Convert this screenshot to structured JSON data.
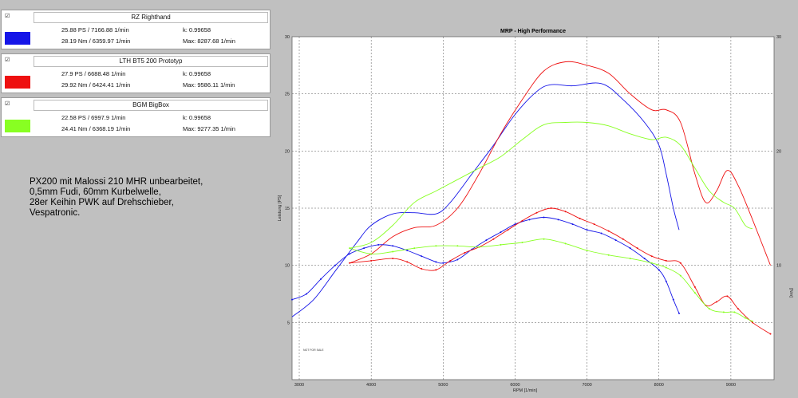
{
  "legend": [
    {
      "name": "RZ Righthand",
      "color": "#1515e8",
      "ps": "25.88 PS / 7166.88 1/min",
      "nm": "28.19 Nm / 6359.97 1/min",
      "k": "k: 0.99658",
      "max": "Max: 8287.68 1/min",
      "checkbox": "☑"
    },
    {
      "name": "LTH BT5 200 Prototyp",
      "color": "#ee1010",
      "ps": "27.9 PS / 6688.48 1/min",
      "nm": "29.92 Nm / 6424.41 1/min",
      "k": "k: 0.99658",
      "max": "Max: 9586.11 1/min",
      "checkbox": "☑"
    },
    {
      "name": "BGM BigBox",
      "color": "#88ff22",
      "ps": "22.58 PS / 6997.9 1/min",
      "nm": "24.41 Nm / 6368.19 1/min",
      "k": "k: 0.99658",
      "max": "Max: 9277.35 1/min",
      "checkbox": "☑"
    }
  ],
  "note_lines": [
    "PX200 mit Malossi 210 MHR unbearbeitet,",
    "0,5mm Fudi, 60mm Kurbelwelle,",
    "28er Keihin PWK auf Drehschieber,",
    "Vespatronic."
  ],
  "chart_data": {
    "type": "line",
    "title": "MRP - High Performance",
    "xlabel": "RPM [1/min]",
    "ylabel": "Leistung [PS]",
    "y2label": "[Nm]",
    "watermark": "NOT FOR SALE",
    "xlim": [
      2900,
      9600
    ],
    "ylim": [
      0,
      30
    ],
    "y2lim": [
      0,
      30
    ],
    "xticks": [
      3000,
      4000,
      5000,
      6000,
      7000,
      8000,
      9000
    ],
    "yticks": [
      5,
      10,
      15,
      20,
      25,
      30
    ],
    "y2ticks": [
      10,
      20,
      30
    ],
    "grid": true,
    "power_series": [
      {
        "name": "RZ Righthand",
        "color": "#1515e8",
        "x": [
          2900,
          3200,
          3500,
          3800,
          4000,
          4300,
          4600,
          4900,
          5100,
          5400,
          5700,
          6000,
          6300,
          6500,
          6800,
          7200,
          7500,
          7800,
          8000,
          8100,
          8200,
          8280
        ],
        "y": [
          5.5,
          7.0,
          9.5,
          12.0,
          13.5,
          14.5,
          14.6,
          14.5,
          15.5,
          18.0,
          20.5,
          23.2,
          25.2,
          25.8,
          25.7,
          25.9,
          24.5,
          22.5,
          20.5,
          18.0,
          15.0,
          13.1
        ]
      },
      {
        "name": "LTH BT5 200 Prototyp",
        "color": "#ee1010",
        "x": [
          3700,
          4000,
          4300,
          4600,
          4900,
          5200,
          5500,
          5800,
          6100,
          6400,
          6700,
          7000,
          7300,
          7600,
          7900,
          8100,
          8300,
          8500,
          8650,
          8800,
          8950,
          9100,
          9300,
          9550
        ],
        "y": [
          10.2,
          11.0,
          12.5,
          13.3,
          13.5,
          15.0,
          18.0,
          21.5,
          24.5,
          27.0,
          27.8,
          27.5,
          26.8,
          25.0,
          23.6,
          23.6,
          22.5,
          18.0,
          15.5,
          16.5,
          18.3,
          17.0,
          14.0,
          10.0
        ]
      },
      {
        "name": "BGM BigBox",
        "color": "#88ff22",
        "x": [
          3700,
          4000,
          4300,
          4600,
          4900,
          5200,
          5500,
          5800,
          6100,
          6400,
          6700,
          7000,
          7300,
          7600,
          7900,
          8100,
          8300,
          8500,
          8700,
          8900,
          9050,
          9200,
          9300
        ],
        "y": [
          11.5,
          12.0,
          13.5,
          15.5,
          16.5,
          17.5,
          18.5,
          19.5,
          21.0,
          22.3,
          22.5,
          22.5,
          22.2,
          21.5,
          21.0,
          21.2,
          20.5,
          18.5,
          16.5,
          15.5,
          15.0,
          13.5,
          13.2
        ]
      }
    ],
    "torque_series": [
      {
        "name": "RZ Righthand",
        "color": "#1515e8",
        "x": [
          2900,
          3100,
          3300,
          3500,
          3700,
          3900,
          4100,
          4300,
          4500,
          4700,
          4900,
          5000,
          5200,
          5400,
          5600,
          5800,
          6000,
          6200,
          6400,
          6600,
          6800,
          7000,
          7200,
          7400,
          7600,
          7800,
          8000,
          8100,
          8200,
          8280
        ],
        "y": [
          7.0,
          7.5,
          8.8,
          10.0,
          11.0,
          11.5,
          11.8,
          11.7,
          11.3,
          10.8,
          10.3,
          10.2,
          10.5,
          11.4,
          12.2,
          12.9,
          13.6,
          14.0,
          14.2,
          14.0,
          13.6,
          13.1,
          12.8,
          12.2,
          11.5,
          10.6,
          9.6,
          8.6,
          7.0,
          5.8
        ]
      },
      {
        "name": "LTH BT5 200 Prototyp",
        "color": "#ee1010",
        "x": [
          3700,
          4000,
          4300,
          4500,
          4700,
          4900,
          5100,
          5300,
          5500,
          5700,
          5900,
          6100,
          6300,
          6500,
          6700,
          6900,
          7100,
          7300,
          7500,
          7700,
          7900,
          8100,
          8300,
          8500,
          8650,
          8800,
          8950,
          9100,
          9300,
          9550
        ],
        "y": [
          10.2,
          10.4,
          10.6,
          10.3,
          9.7,
          9.6,
          10.4,
          11.1,
          11.6,
          12.3,
          13.1,
          13.9,
          14.6,
          15.0,
          14.7,
          14.1,
          13.6,
          13.0,
          12.3,
          11.5,
          10.8,
          10.4,
          10.2,
          8.1,
          6.5,
          6.8,
          7.3,
          6.2,
          5.0,
          4.0
        ]
      },
      {
        "name": "BGM BigBox",
        "color": "#88ff22",
        "x": [
          3700,
          4000,
          4300,
          4600,
          4900,
          5200,
          5500,
          5800,
          6100,
          6400,
          6700,
          7000,
          7300,
          7600,
          7900,
          8100,
          8300,
          8500,
          8700,
          8900,
          9050,
          9200,
          9300
        ],
        "y": [
          11.5,
          11.0,
          11.2,
          11.5,
          11.7,
          11.7,
          11.6,
          11.8,
          12.0,
          12.3,
          11.9,
          11.3,
          10.9,
          10.6,
          10.2,
          9.8,
          9.1,
          7.6,
          6.2,
          5.9,
          5.9,
          5.4,
          5.1
        ]
      }
    ]
  }
}
